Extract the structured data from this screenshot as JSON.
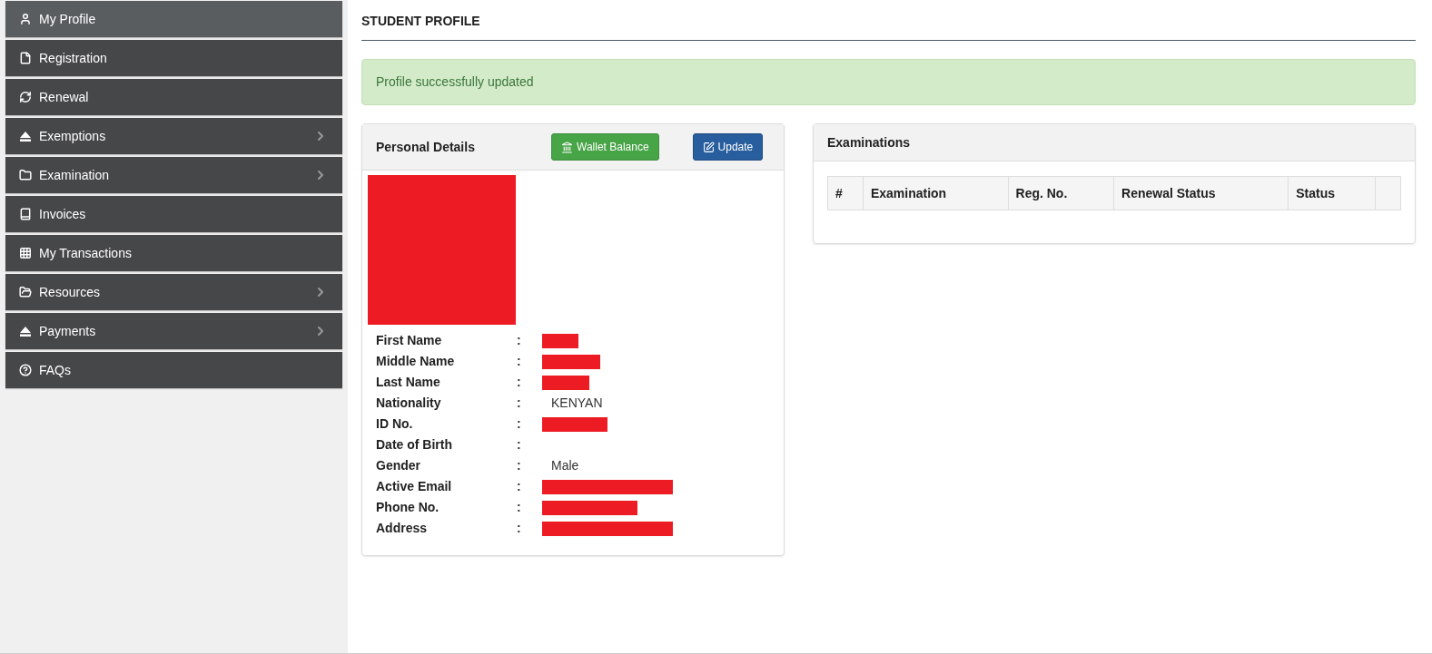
{
  "sidebar": {
    "items": [
      {
        "label": "My Profile",
        "selected": true,
        "has_submenu": false
      },
      {
        "label": "Registration",
        "selected": false,
        "has_submenu": false
      },
      {
        "label": "Renewal",
        "selected": false,
        "has_submenu": false
      },
      {
        "label": "Exemptions",
        "selected": false,
        "has_submenu": true
      },
      {
        "label": "Examination",
        "selected": false,
        "has_submenu": true
      },
      {
        "label": "Invoices",
        "selected": false,
        "has_submenu": false
      },
      {
        "label": "My Transactions",
        "selected": false,
        "has_submenu": false
      },
      {
        "label": "Resources",
        "selected": false,
        "has_submenu": true
      },
      {
        "label": "Payments",
        "selected": false,
        "has_submenu": true
      },
      {
        "label": "FAQs",
        "selected": false,
        "has_submenu": false
      }
    ]
  },
  "page_title": "STUDENT PROFILE",
  "alert": {
    "message": "Profile successfully updated"
  },
  "personal_details": {
    "title": "Personal Details",
    "buttons": [
      {
        "label": "Wallet Balance",
        "kind": "success"
      },
      {
        "label": "Update",
        "kind": "primary"
      }
    ],
    "photo": {
      "kind": "redacted"
    },
    "fields": [
      {
        "label": "First Name",
        "separator": ":",
        "kind": "redacted"
      },
      {
        "label": "Middle Name",
        "separator": ":",
        "kind": "redacted"
      },
      {
        "label": "Last Name",
        "separator": ":",
        "kind": "redacted"
      },
      {
        "label": "Nationality",
        "separator": ":",
        "kind": "text",
        "value": "KENYAN"
      },
      {
        "label": "ID No.",
        "separator": ":",
        "kind": "redacted"
      },
      {
        "label": "Date of Birth",
        "separator": ":",
        "kind": "empty"
      },
      {
        "label": "Gender",
        "separator": ":",
        "kind": "text",
        "value": "Male"
      },
      {
        "label": "Active Email",
        "separator": ":",
        "kind": "redacted"
      },
      {
        "label": "Phone No.",
        "separator": ":",
        "kind": "redacted"
      },
      {
        "label": "Address",
        "separator": ":",
        "kind": "redacted"
      }
    ]
  },
  "examinations": {
    "title": "Examinations",
    "table": {
      "columns": [
        "#",
        "Examination",
        "Reg. No.",
        "Renewal Status",
        "Status",
        ""
      ]
    }
  }
}
